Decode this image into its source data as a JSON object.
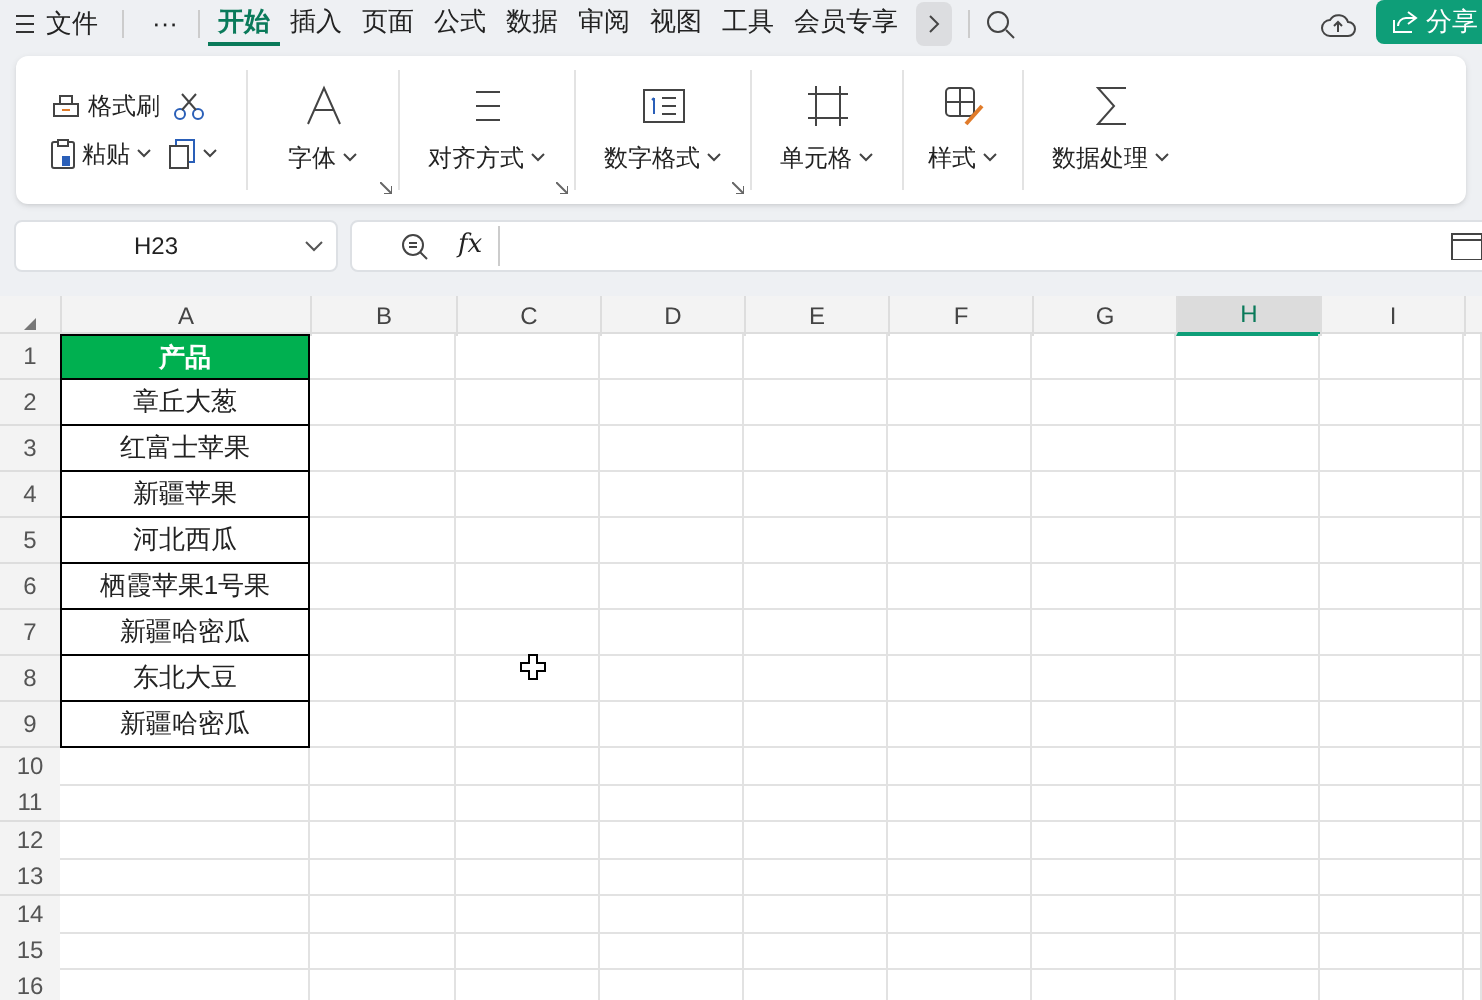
{
  "menu_bar": {
    "file_menu": "文件",
    "more": "···",
    "tabs": [
      {
        "label": "开始",
        "selected": true
      },
      {
        "label": "插入",
        "selected": false
      },
      {
        "label": "页面",
        "selected": false
      },
      {
        "label": "公式",
        "selected": false
      },
      {
        "label": "数据",
        "selected": false
      },
      {
        "label": "审阅",
        "selected": false
      },
      {
        "label": "视图",
        "selected": false
      },
      {
        "label": "工具",
        "selected": false
      },
      {
        "label": "会员专享",
        "selected": false
      }
    ],
    "share_button": "分享"
  },
  "ribbon": {
    "clipboard": {
      "format_painter": "格式刷",
      "paste": "粘贴"
    },
    "groups": [
      {
        "kind": "font",
        "label": "字体",
        "launcher": true
      },
      {
        "kind": "align",
        "label": "对齐方式",
        "launcher": true
      },
      {
        "kind": "number",
        "label": "数字格式",
        "launcher": true
      },
      {
        "kind": "cell",
        "label": "单元格",
        "launcher": false
      },
      {
        "kind": "style",
        "label": "样式",
        "launcher": false
      },
      {
        "kind": "data",
        "label": "数据处理",
        "launcher": false
      }
    ]
  },
  "formula_bar": {
    "name_box": "H23",
    "formula_label": "fx"
  },
  "sheet": {
    "columns": [
      {
        "label": "A",
        "selected": false
      },
      {
        "label": "B",
        "selected": false
      },
      {
        "label": "C",
        "selected": false
      },
      {
        "label": "D",
        "selected": false
      },
      {
        "label": "E",
        "selected": false
      },
      {
        "label": "F",
        "selected": false
      },
      {
        "label": "G",
        "selected": false
      },
      {
        "label": "H",
        "selected": true
      },
      {
        "label": "I",
        "selected": false
      }
    ],
    "rows": [
      "1",
      "2",
      "3",
      "4",
      "5",
      "6",
      "7",
      "8",
      "9",
      "10",
      "11",
      "12",
      "13",
      "14",
      "15",
      "16"
    ],
    "table": {
      "header": "产品",
      "cells": [
        "章丘大葱",
        "红富士苹果",
        "新疆苹果",
        "河北西瓜",
        "栖霞苹果1号果",
        "新疆哈密瓜",
        "东北大豆",
        "新疆哈密瓜"
      ]
    }
  }
}
